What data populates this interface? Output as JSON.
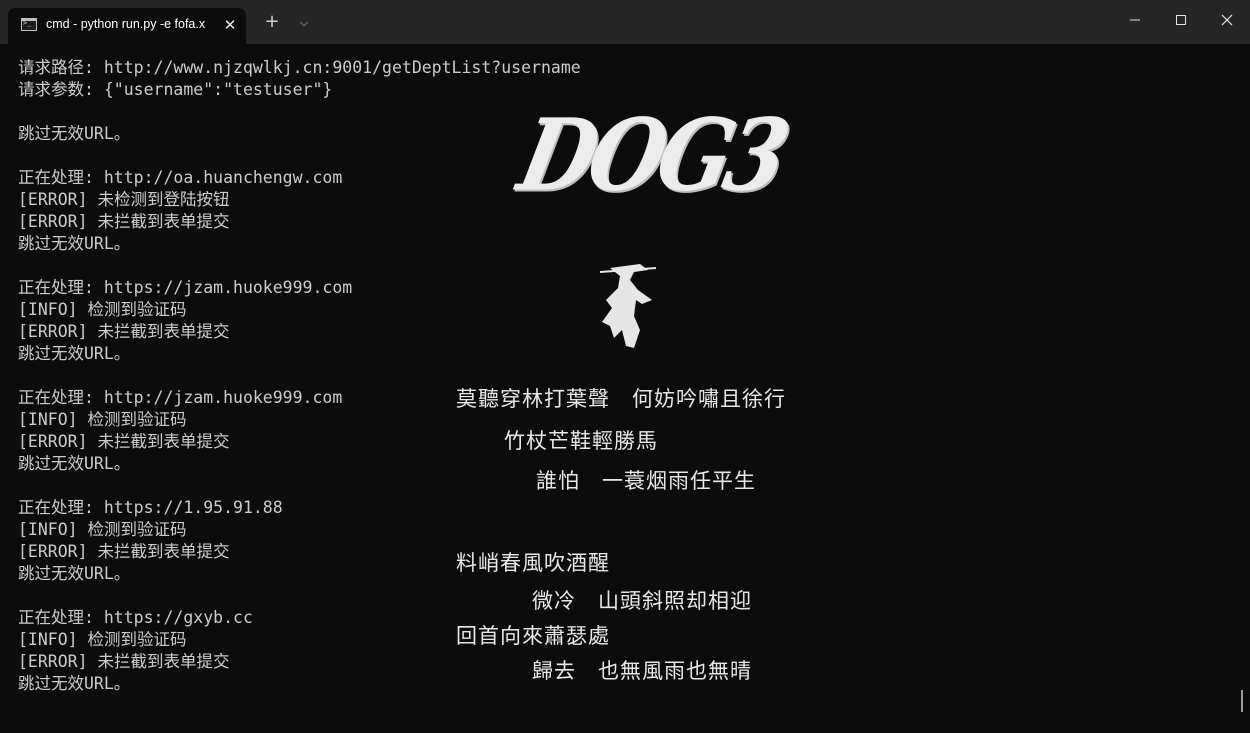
{
  "tab": {
    "title": "cmd - python  run.py -e fofa.x",
    "close_glyph": "✕"
  },
  "tabbar": {
    "new_tab_glyph": "+",
    "dropdown_glyph": "⌵"
  },
  "background": {
    "logo_text": "DOG3",
    "poem_lines": [
      "莫聽穿林打葉聲　何妨吟嘯且徐行",
      "竹杖芒鞋輕勝馬",
      "誰怕　一蓑烟雨任平生",
      "料峭春風吹酒醒",
      "微冷　山頭斜照却相迎",
      "回首向來蕭瑟處",
      "歸去　也無風雨也無晴"
    ]
  },
  "terminal": {
    "lines": [
      "请求路径: http://www.njzqwlkj.cn:9001/getDeptList?username",
      "请求参数: {\"username\":\"testuser\"}",
      "",
      "跳过无效URL。",
      "",
      "正在处理: http://oa.huanchengw.com",
      "[ERROR] 未检测到登陆按钮",
      "[ERROR] 未拦截到表单提交",
      "跳过无效URL。",
      "",
      "正在处理: https://jzam.huoke999.com",
      "[INFO] 检测到验证码",
      "[ERROR] 未拦截到表单提交",
      "跳过无效URL。",
      "",
      "正在处理: http://jzam.huoke999.com",
      "[INFO] 检测到验证码",
      "[ERROR] 未拦截到表单提交",
      "跳过无效URL。",
      "",
      "正在处理: https://1.95.91.88",
      "[INFO] 检测到验证码",
      "[ERROR] 未拦截到表单提交",
      "跳过无效URL。",
      "",
      "正在处理: https://gxyb.cc",
      "[INFO] 检测到验证码",
      "[ERROR] 未拦截到表单提交",
      "跳过无效URL。"
    ]
  },
  "colors": {
    "terminal_bg": "#0c0c0c",
    "terminal_text": "#cccccc",
    "titlebar_bg": "#262626"
  }
}
